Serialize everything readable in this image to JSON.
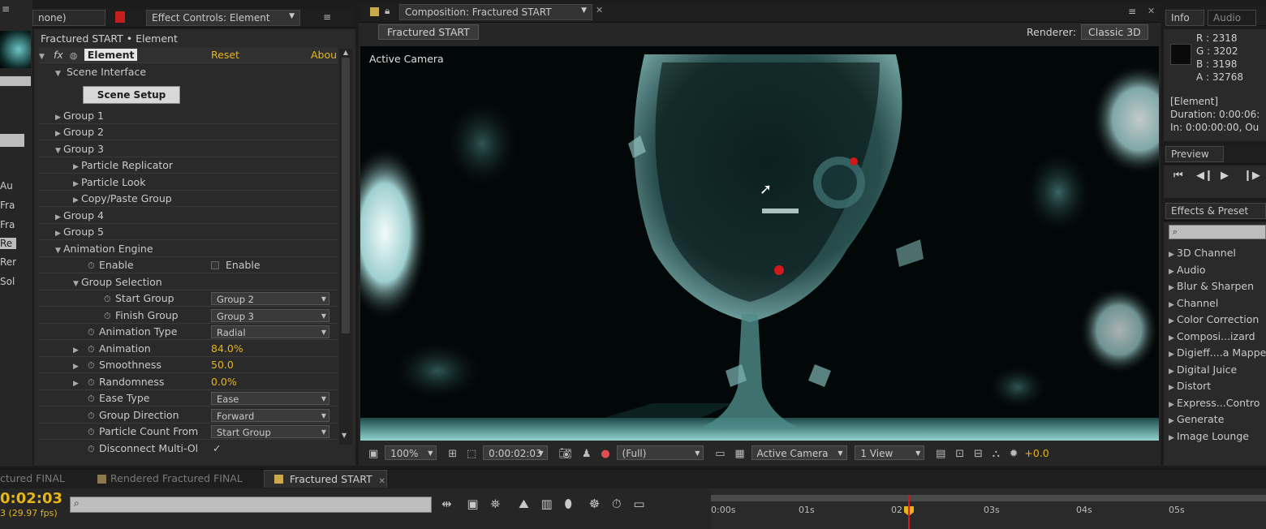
{
  "left_stub": {
    "tab": "none)",
    "items": [
      "Au",
      "Fra",
      "Fra",
      "Re",
      "Rer",
      "Sol"
    ]
  },
  "effect_controls": {
    "tab_title": "Effect Controls: Element",
    "header": "Fractured START • Element",
    "effect": {
      "fx": "fx",
      "name": "Element",
      "reset": "Reset",
      "about": "Abou"
    },
    "scene_interface": "Scene Interface",
    "scene_setup_button": "Scene Setup",
    "rows": [
      {
        "label": "Group 1"
      },
      {
        "label": "Group 2"
      },
      {
        "label": "Group 3"
      },
      {
        "label": "Particle Replicator"
      },
      {
        "label": "Particle Look"
      },
      {
        "label": "Copy/Paste Group"
      },
      {
        "label": "Group 4"
      },
      {
        "label": "Group 5"
      },
      {
        "label": "Animation Engine"
      },
      {
        "label": "Enable",
        "value": "Enable"
      },
      {
        "label": "Group Selection"
      },
      {
        "label": "Start Group",
        "value": "Group 2"
      },
      {
        "label": "Finish Group",
        "value": "Group 3"
      },
      {
        "label": "Animation Type",
        "value": "Radial"
      },
      {
        "label": "Animation",
        "value": "84.0%"
      },
      {
        "label": "Smoothness",
        "value": "50.0"
      },
      {
        "label": "Randomness",
        "value": "0.0%"
      },
      {
        "label": "Ease Type",
        "value": "Ease"
      },
      {
        "label": "Group Direction",
        "value": "Forward"
      },
      {
        "label": "Particle Count From",
        "value": "Start Group"
      },
      {
        "label": "Disconnect Multi-Ol",
        "value": "✓"
      }
    ]
  },
  "composition": {
    "tab_title": "Composition: Fractured START",
    "comp_button": "Fractured START",
    "renderer_label": "Renderer:",
    "renderer_value": "Classic 3D",
    "viewer_label": "Active Camera",
    "toolbar": {
      "zoom": "100%",
      "timecode": "0:00:02:03",
      "resolution": "(Full)",
      "view": "Active Camera",
      "views": "1 View",
      "exposure": "+0.0"
    }
  },
  "info": {
    "tab_info": "Info",
    "tab_audio": "Audio",
    "r": "R : 2318",
    "g": "G : 3202",
    "b": "B : 3198",
    "a": "A : 32768",
    "layer": "[Element]",
    "duration": "Duration: 0:00:06:",
    "in": "In: 0:00:00:00, Ou"
  },
  "preview": {
    "tab": "Preview"
  },
  "effects_presets": {
    "tab": "Effects & Preset",
    "items": [
      "3D Channel",
      "Audio",
      "Blur & Sharpen",
      "Channel",
      "Color Correction",
      "Composi...izard",
      "Digieff....a Mappe",
      "Digital Juice",
      "Distort",
      "Express...Contro",
      "Generate",
      "Image Lounge"
    ]
  },
  "timeline": {
    "tabs": [
      "ctured FINAL",
      "Rendered Fractured FINAL",
      "Fractured START"
    ],
    "timecode": "0:02:03",
    "fps": "3 (29.97 fps)",
    "ruler": [
      "0:00s",
      "01s",
      "02",
      "03s",
      "04s",
      "05s"
    ]
  },
  "colors": {
    "accent": "#e6b51a",
    "panel": "#2a2a2a",
    "teal": "#4fb3b0"
  }
}
